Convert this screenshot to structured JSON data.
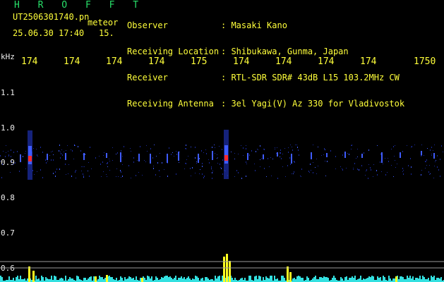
{
  "header": {
    "station": "H R O F F T",
    "filename": "UT2506301740.pn",
    "tag": "meteor",
    "datetime": "25.06.30 17:40",
    "number": "15."
  },
  "info": {
    "labels": [
      "Observer",
      "Receiving Location",
      "Receiver",
      "Receiving Antenna"
    ],
    "values": [
      ": Masaki Kano",
      ": Shibukawa, Gunma, Japan",
      ": RTL-SDR SDR# 43dB L15 103.2MHz CW",
      ": 3el Yagi(V) Az 330 for Vladivostok"
    ]
  },
  "spectrogram": {
    "unit_label": "kHz",
    "minute_ticks": [
      "174",
      "174",
      "174",
      "174",
      "175",
      "174",
      "174",
      "174",
      "174",
      "1750"
    ],
    "freq_ticks": [
      "1.1",
      "1.0",
      "0.9",
      "0.8",
      "0.7",
      "0.6"
    ],
    "colors": {
      "background": "#000000",
      "signal_low": "#1a2a9a",
      "signal_mid": "#3f5cff",
      "signal_high": "#ff2a2a",
      "peak_bar": "#ffff20",
      "noise_floor": "#33e0e0"
    }
  }
}
